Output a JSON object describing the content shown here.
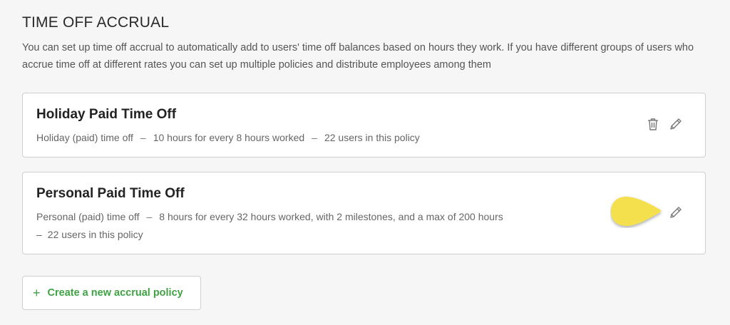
{
  "section": {
    "title": "TIME OFF ACCRUAL",
    "description": "You can set up time off accrual to automatically add to users' time off balances based on hours they work. If you have different groups of users who accrue time off at different rates you can set up multiple policies and distribute employees among them"
  },
  "policies": [
    {
      "name": "Holiday Paid Time Off",
      "type": "Holiday (paid) time off",
      "rule": "10 hours for every 8 hours worked",
      "users": "22 users in this policy",
      "separator": "–",
      "icons": [
        "trash-icon",
        "pencil-icon"
      ]
    },
    {
      "name": "Personal Paid Time Off",
      "type": "Personal (paid) time off",
      "rule": "8 hours for every 32 hours worked, with 2 milestones, and a max of 200 hours",
      "users": "22 users in this policy",
      "separator": "–",
      "icons": [
        "pencil-icon"
      ]
    }
  ],
  "create_button": {
    "icon": "+",
    "label": "Create a new accrual policy"
  },
  "colors": {
    "accent_green": "#3fa243",
    "highlight_yellow": "#f4e04d",
    "background": "#f6f6f6"
  }
}
